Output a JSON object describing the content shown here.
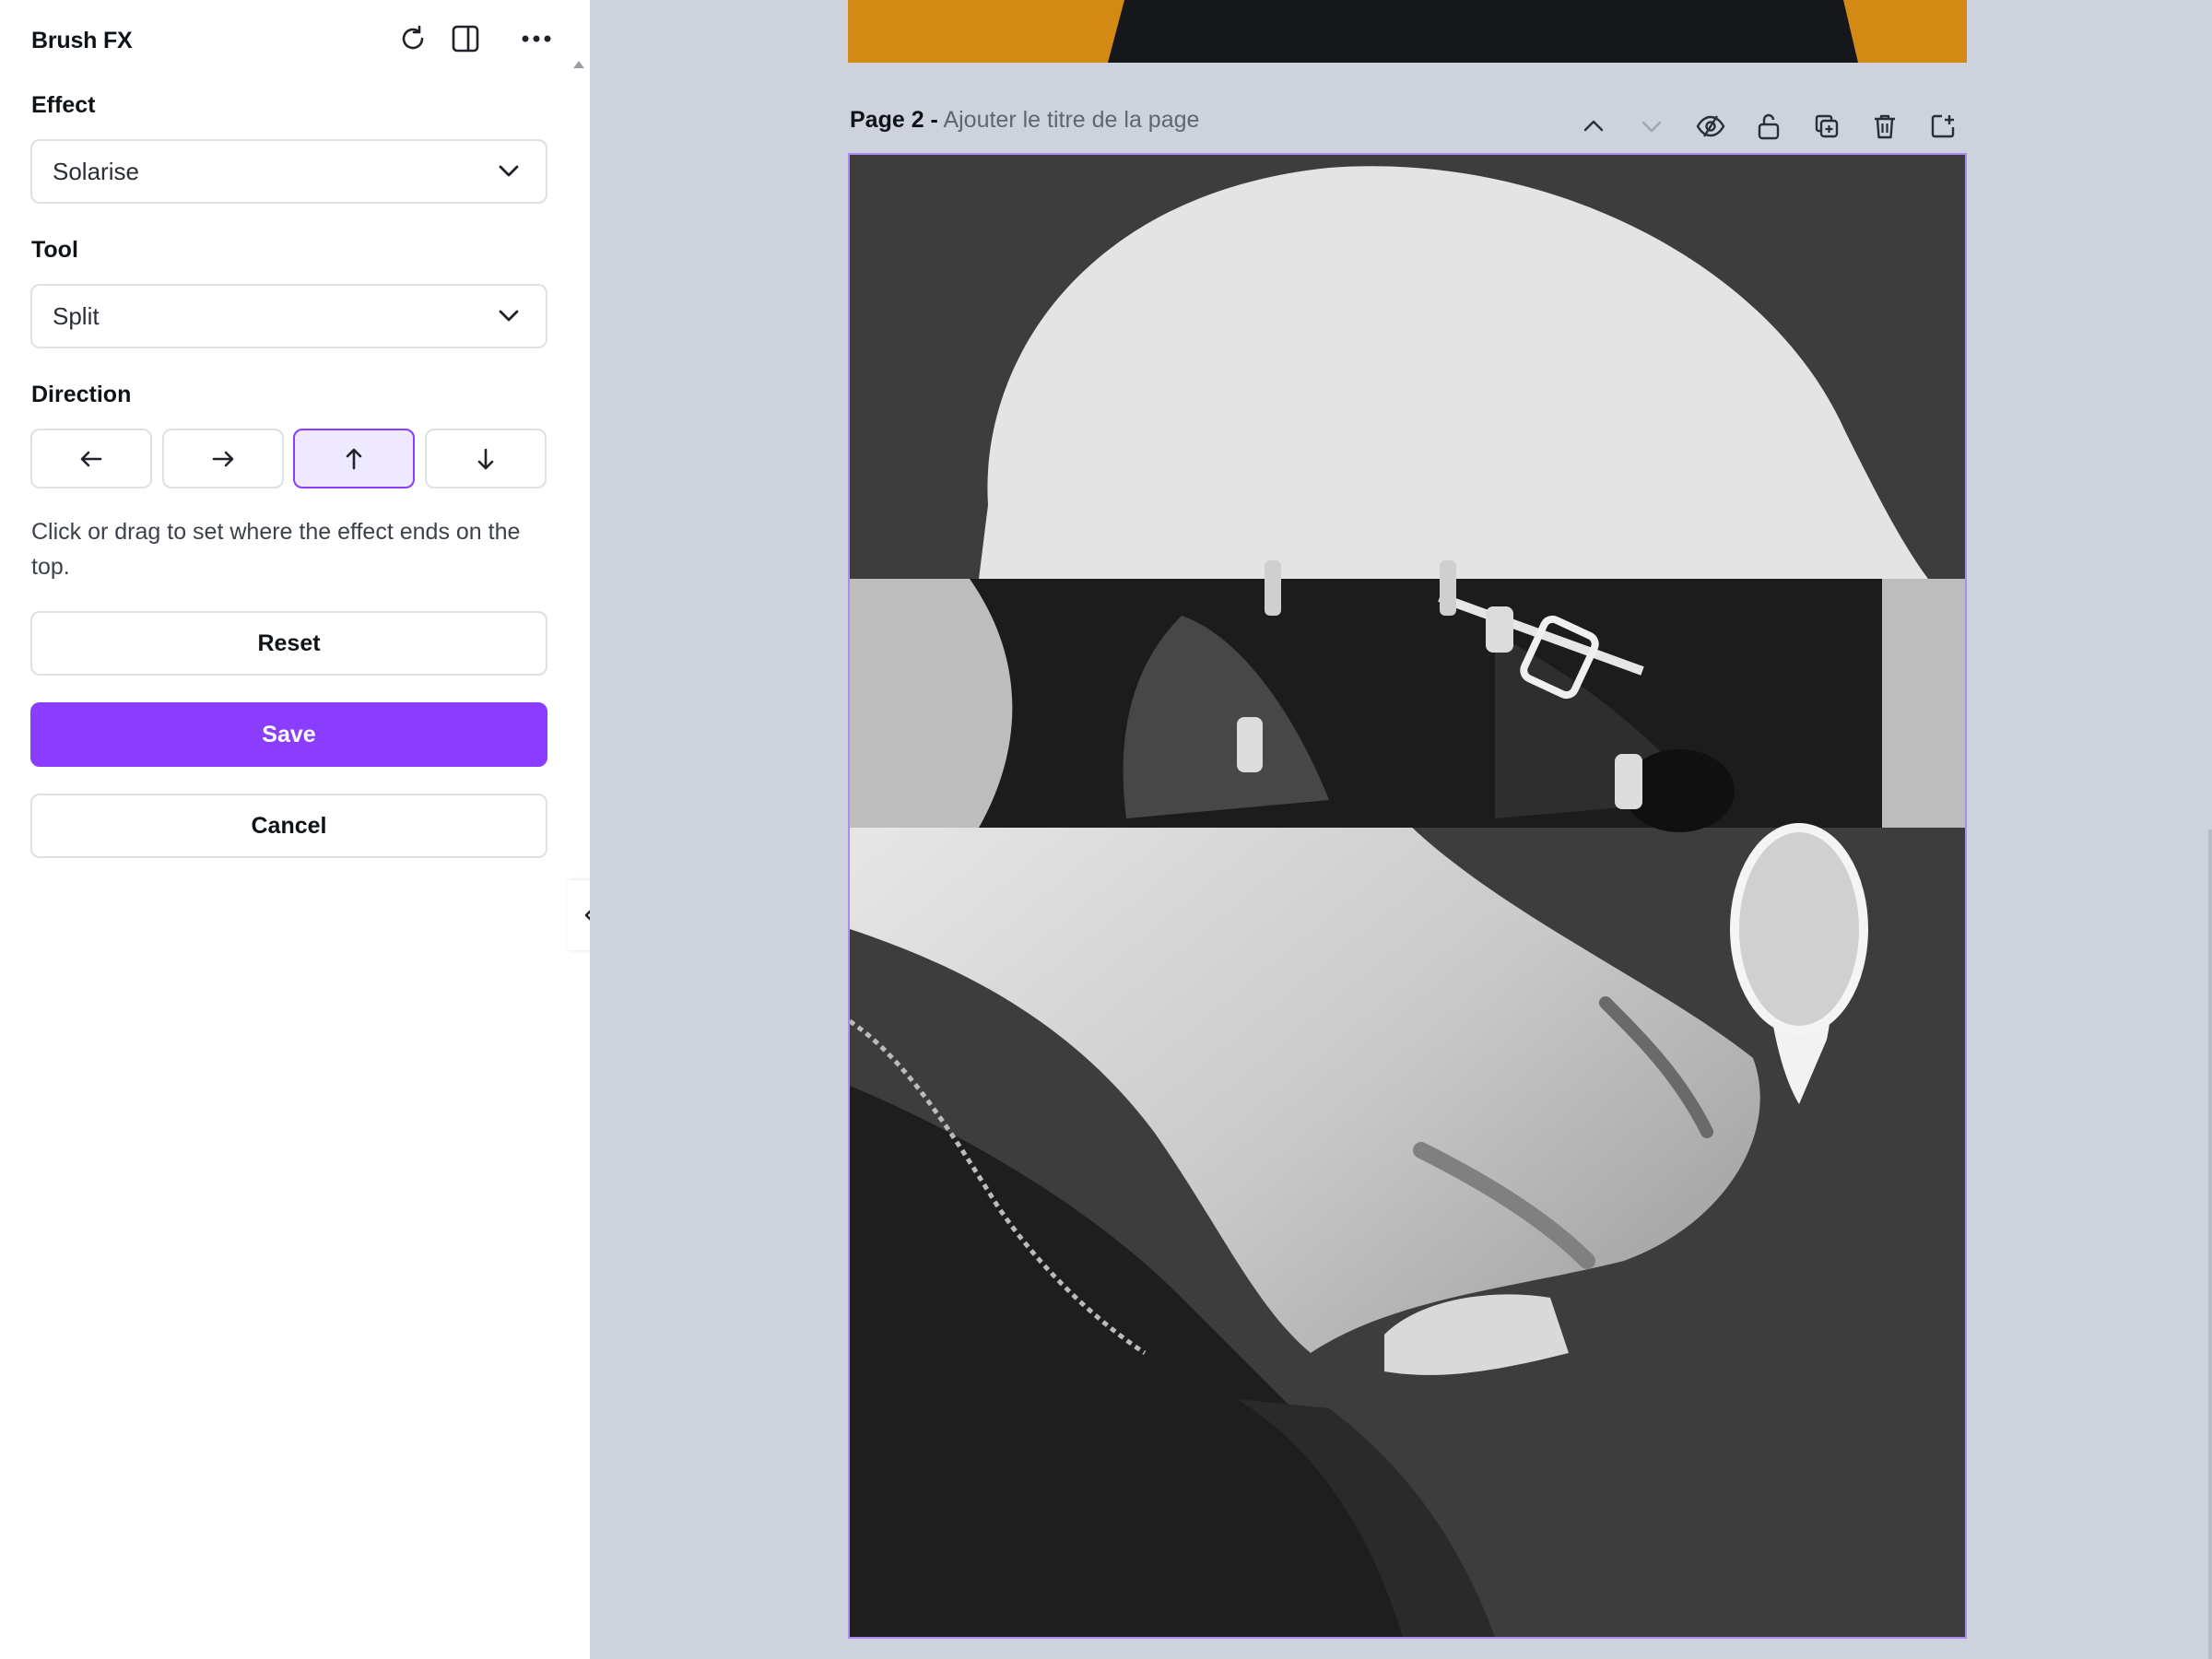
{
  "panel": {
    "title": "Brush FX",
    "header_icons": [
      "rotate-icon",
      "split-view-icon",
      "more-icon"
    ],
    "effect": {
      "label": "Effect",
      "value": "Solarise"
    },
    "tool": {
      "label": "Tool",
      "value": "Split"
    },
    "direction": {
      "label": "Direction",
      "options": [
        "left-arrow-icon",
        "right-arrow-icon",
        "up-arrow-icon",
        "down-arrow-icon"
      ],
      "selected": "up"
    },
    "hint": "Click or drag to set where the effect ends on the top.",
    "reset_label": "Reset",
    "save_label": "Save",
    "cancel_label": "Cancel"
  },
  "canvas": {
    "page_label": "Page 2 -",
    "page_title_placeholder": "Ajouter le titre de la page",
    "page_tools": [
      "chevron-up-icon",
      "chevron-down-icon",
      "hide-icon",
      "lock-icon",
      "duplicate-icon",
      "delete-icon",
      "add-page-icon"
    ]
  },
  "colors": {
    "accent": "#8b3dff",
    "page1_bg": "#d28a14",
    "canvas_bg": "#ced2dd"
  }
}
